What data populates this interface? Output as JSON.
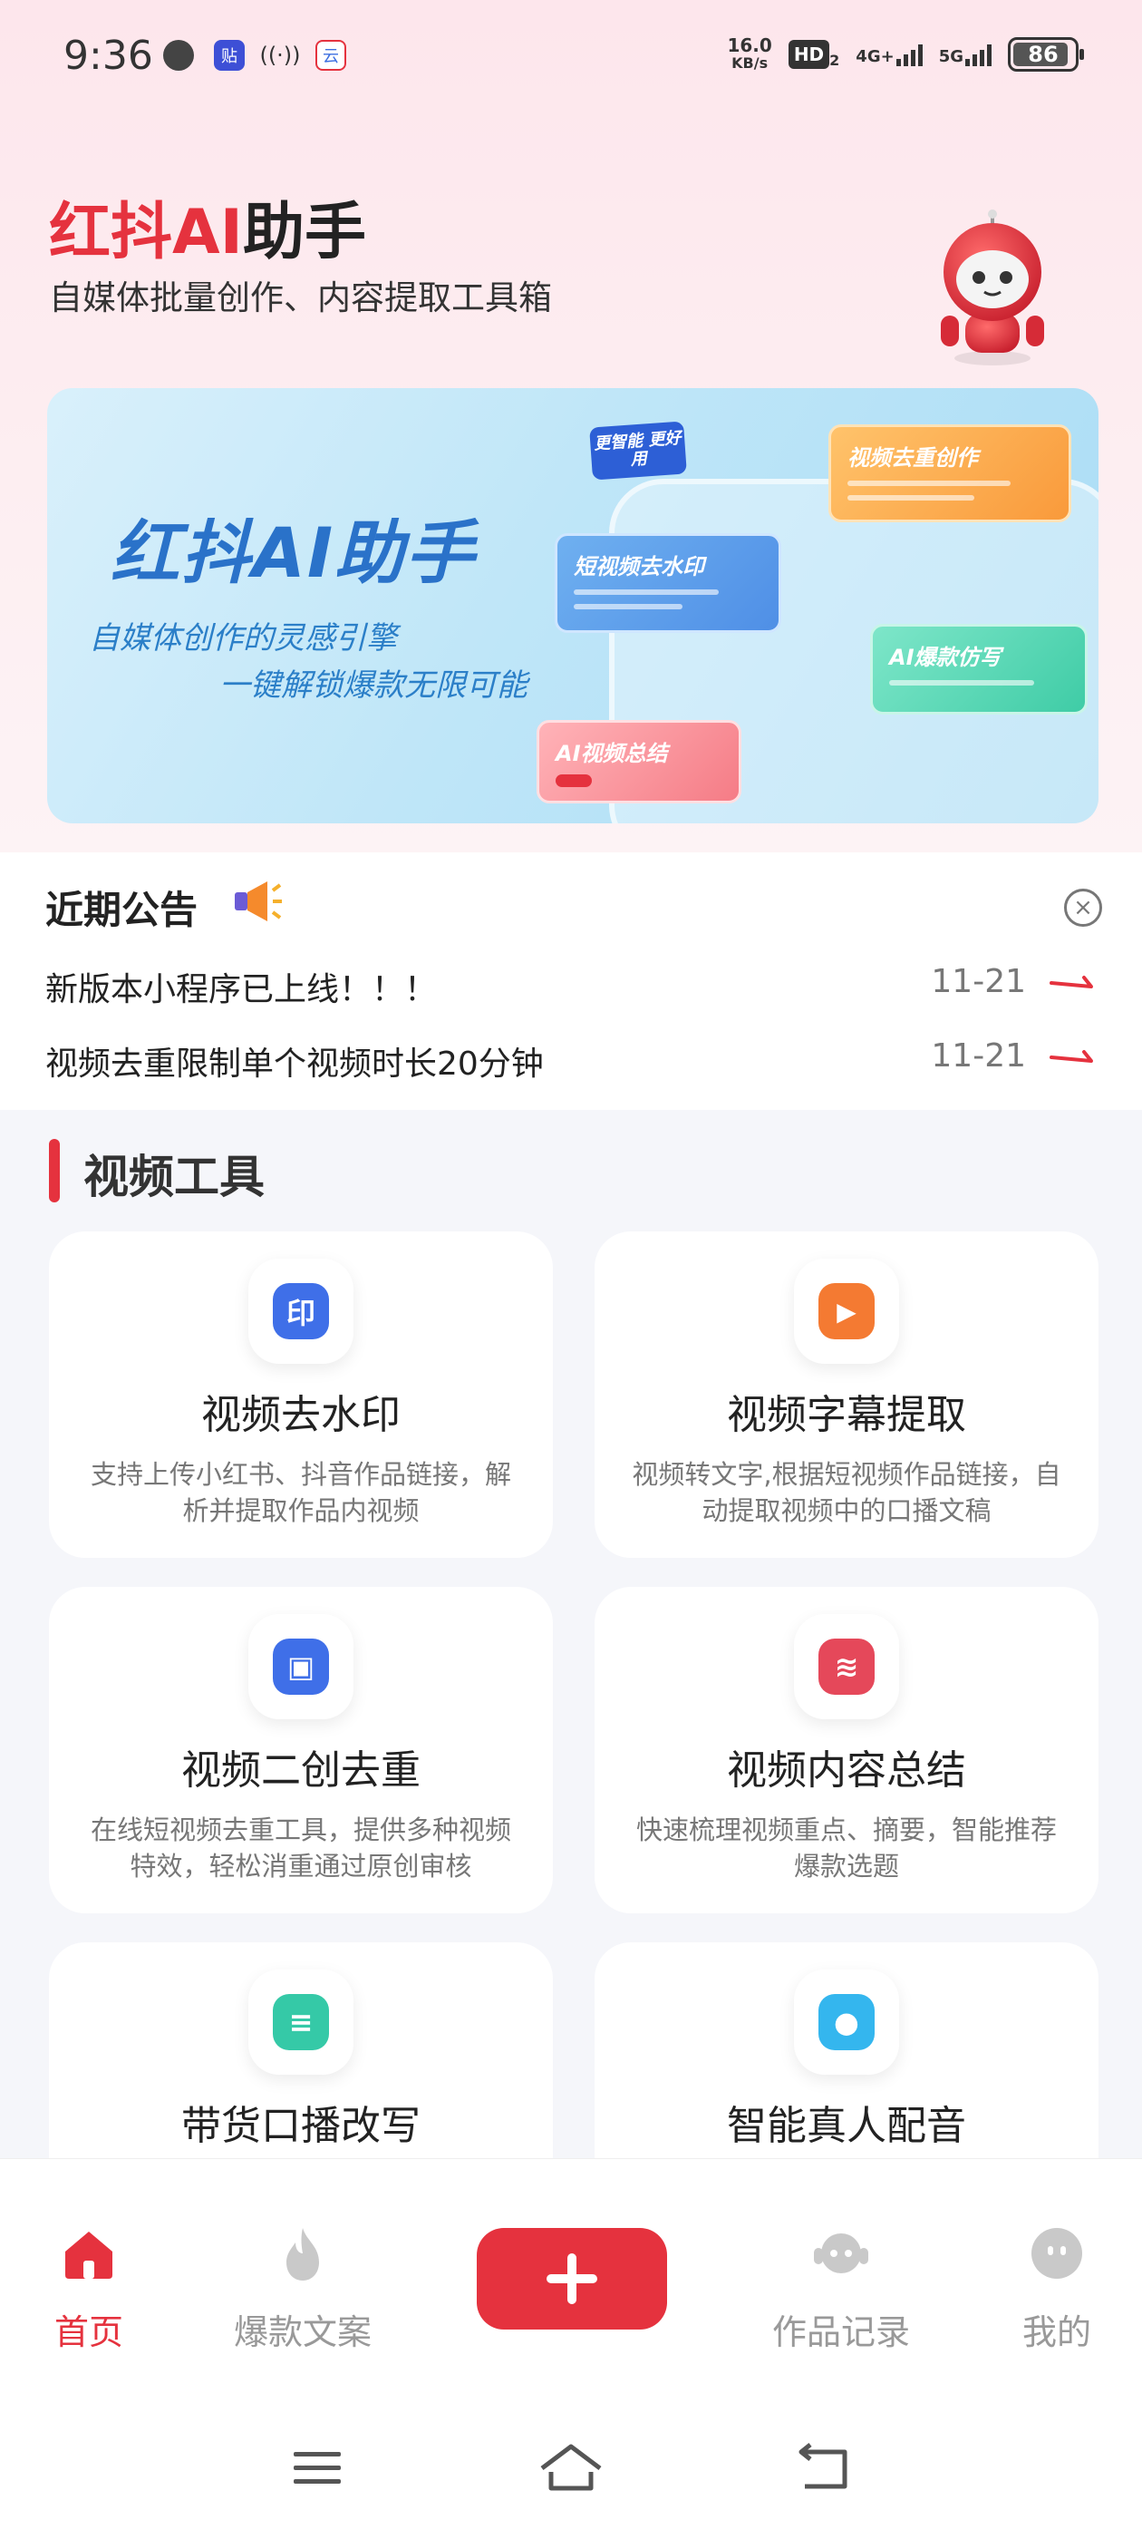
{
  "status_bar": {
    "time": "9:36",
    "net_speed_value": "16.0",
    "net_speed_unit": "KB/s",
    "hd": "HD",
    "hd_sub": "2",
    "signal_4g": "4G+",
    "signal_5g": "5G",
    "battery": "86",
    "icons": [
      "weather-icon",
      "notes-icon",
      "hotspot-icon",
      "cloud-icon"
    ]
  },
  "header": {
    "title_brand": "红抖AI",
    "title_rest": "助手",
    "subtitle": "自媒体批量创作、内容提取工具箱"
  },
  "banner": {
    "title": "红抖AI助手",
    "line1": "自媒体创作的灵感引擎",
    "line2": "一键解锁爆款无限可能",
    "badge": "更智能 更好用",
    "cards": [
      "短视频去水印",
      "视频去重创作",
      "AI爆款仿写",
      "AI视频总结"
    ]
  },
  "notice": {
    "title": "近期公告",
    "items": [
      {
        "text": "新版本小程序已上线！！！",
        "date": "11-21"
      },
      {
        "text": "视频去重限制单个视频时长20分钟",
        "date": "11-21"
      }
    ]
  },
  "section": {
    "title": "视频工具"
  },
  "tools": [
    {
      "name": "视频去水印",
      "desc": "支持上传小红书、抖音作品链接，解析并提取作品内视频",
      "icon": "watermark-stamp-icon",
      "icon_text": "印",
      "color": "#3f6fe8"
    },
    {
      "name": "视频字幕提取",
      "desc": "视频转文字,根据短视频作品链接，自动提取视频中的口播文稿",
      "icon": "play-icon",
      "icon_text": "▶",
      "color": "#f47a32"
    },
    {
      "name": "视频二创去重",
      "desc": "在线短视频去重工具，提供多种视频特效，轻松消重通过原创审核",
      "icon": "video-edit-icon",
      "icon_text": "▣",
      "color": "#3f6fe8"
    },
    {
      "name": "视频内容总结",
      "desc": "快速梳理视频重点、摘要，智能推荐爆款选题",
      "icon": "chart-doc-icon",
      "icon_text": "≋",
      "color": "#e5485a"
    },
    {
      "name": "带货口播改写",
      "desc": "",
      "icon": "document-icon",
      "icon_text": "≡",
      "color": "#35c9a7"
    },
    {
      "name": "智能真人配音",
      "desc": "",
      "icon": "microphone-icon",
      "icon_text": "●",
      "color": "#34b6ee"
    }
  ],
  "tab_bar": {
    "home": "首页",
    "hot": "爆款文案",
    "works": "作品记录",
    "mine": "我的",
    "plus_icon": "plus-icon"
  },
  "colors": {
    "accent": "#e5323e",
    "banner_blue": "#2a72c9"
  }
}
